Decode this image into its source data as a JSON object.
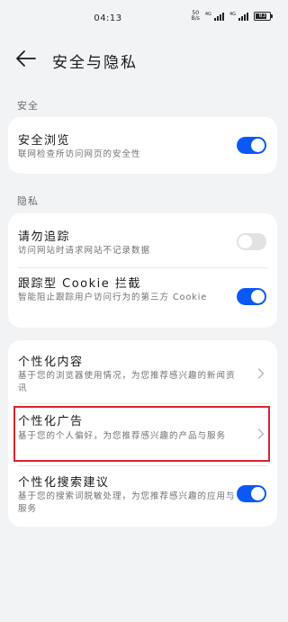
{
  "status_bar": {
    "time": "04:13",
    "net_speed_value": "50",
    "net_speed_unit": "B/s",
    "signal1_tag": "4G",
    "signal2_tag": "4G",
    "battery_level": "83"
  },
  "header": {
    "back_icon": "arrow-left-icon",
    "title": "安全与隐私"
  },
  "sections": {
    "security_label": "安全",
    "privacy_label": "隐私"
  },
  "security": {
    "safe_browsing": {
      "title": "安全浏览",
      "subtitle": "联网检查所访问网页的安全性",
      "toggle_on": true
    }
  },
  "privacy": {
    "do_not_track": {
      "title": "请勿追踪",
      "subtitle": "访问网站时请求网站不记录数据",
      "toggle_on": false
    },
    "cookie_block": {
      "title": "跟踪型 Cookie 拦截",
      "subtitle": "智能阻止跟踪用户访问行为的第三方 Cookie",
      "toggle_on": true
    }
  },
  "personalization": {
    "content": {
      "title": "个性化内容",
      "subtitle": "基于您的浏览器使用情况，为您推荐感兴趣的新闻资讯"
    },
    "ads": {
      "title": "个性化广告",
      "subtitle": "基于您的个人偏好，为您推荐感兴趣的产品与服务"
    },
    "search_suggestions": {
      "title": "个性化搜索建议",
      "subtitle": "基于您的搜索词脱敏处理，为您推荐感兴趣的应用与服务",
      "toggle_on": true
    }
  },
  "colors": {
    "accent": "#0a59f7",
    "highlight": "#d9232d",
    "background": "#f1f3f5"
  }
}
